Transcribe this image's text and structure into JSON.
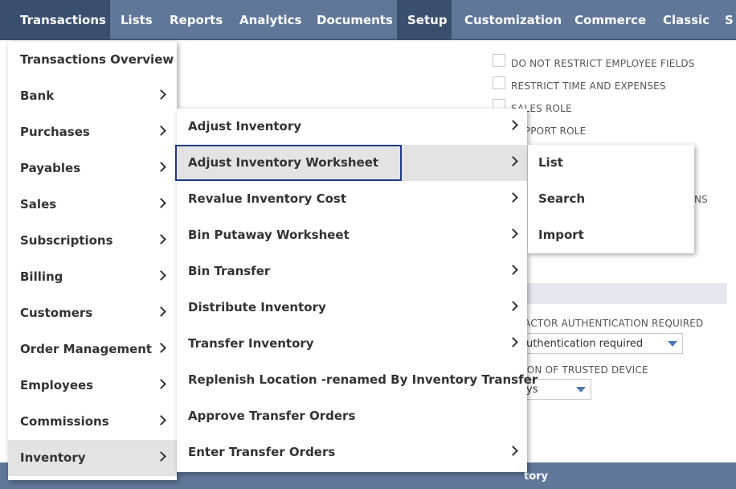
{
  "nav": {
    "tabs": [
      {
        "label": "Transactions",
        "active": true
      },
      {
        "label": "Lists",
        "active": false
      },
      {
        "label": "Reports",
        "active": false
      },
      {
        "label": "Analytics",
        "active": false
      },
      {
        "label": "Documents",
        "active": false
      },
      {
        "label": "Setup",
        "active": true
      },
      {
        "label": "Customization",
        "active": false
      },
      {
        "label": "Commerce",
        "active": false
      },
      {
        "label": "Classic",
        "active": false
      },
      {
        "label": "S",
        "active": false
      }
    ]
  },
  "background": {
    "checkboxes": [
      "DO NOT RESTRICT EMPLOYEE FIELDS",
      "RESTRICT TIME AND EXPENSES",
      "SALES ROLE",
      "SUPPORT ROLE"
    ],
    "partial_label_ns": "NS",
    "two_factor_label": "ACTOR AUTHENTICATION REQUIRED",
    "two_factor_value": "uthentication required",
    "trusted_device_label": "ION OF TRUSTED DEVICE",
    "trusted_device_value": "ys",
    "bottom_strip_text": "tory"
  },
  "menu_level1": {
    "items": [
      {
        "label": "Transactions Overview",
        "has_submenu": false,
        "highlighted": false
      },
      {
        "label": "Bank",
        "has_submenu": true,
        "highlighted": false
      },
      {
        "label": "Purchases",
        "has_submenu": true,
        "highlighted": false
      },
      {
        "label": "Payables",
        "has_submenu": true,
        "highlighted": false
      },
      {
        "label": "Sales",
        "has_submenu": true,
        "highlighted": false
      },
      {
        "label": "Subscriptions",
        "has_submenu": true,
        "highlighted": false
      },
      {
        "label": "Billing",
        "has_submenu": true,
        "highlighted": false
      },
      {
        "label": "Customers",
        "has_submenu": true,
        "highlighted": false
      },
      {
        "label": "Order Management",
        "has_submenu": true,
        "highlighted": false
      },
      {
        "label": "Employees",
        "has_submenu": true,
        "highlighted": false
      },
      {
        "label": "Commissions",
        "has_submenu": true,
        "highlighted": false
      },
      {
        "label": "Inventory",
        "has_submenu": true,
        "highlighted": true
      }
    ]
  },
  "menu_level2": {
    "items": [
      {
        "label": "Adjust Inventory",
        "has_submenu": true,
        "selected": false
      },
      {
        "label": "Adjust Inventory Worksheet",
        "has_submenu": true,
        "selected": true
      },
      {
        "label": "Revalue Inventory Cost",
        "has_submenu": true,
        "selected": false
      },
      {
        "label": "Bin Putaway Worksheet",
        "has_submenu": true,
        "selected": false
      },
      {
        "label": "Bin Transfer",
        "has_submenu": true,
        "selected": false
      },
      {
        "label": "Distribute Inventory",
        "has_submenu": true,
        "selected": false
      },
      {
        "label": "Transfer Inventory",
        "has_submenu": true,
        "selected": false
      },
      {
        "label": "Replenish Location -renamed By Inventory Transfer",
        "has_submenu": false,
        "selected": false
      },
      {
        "label": "Approve Transfer Orders",
        "has_submenu": false,
        "selected": false
      },
      {
        "label": "Enter Transfer Orders",
        "has_submenu": true,
        "selected": false
      }
    ]
  },
  "menu_level3": {
    "items": [
      {
        "label": "List"
      },
      {
        "label": "Search"
      },
      {
        "label": "Import"
      }
    ]
  },
  "colors": {
    "nav_bg": "#607799",
    "nav_active": "#3a4f6e",
    "selection_border": "#1e3a8a",
    "highlight_bg": "#e3e3e3"
  }
}
